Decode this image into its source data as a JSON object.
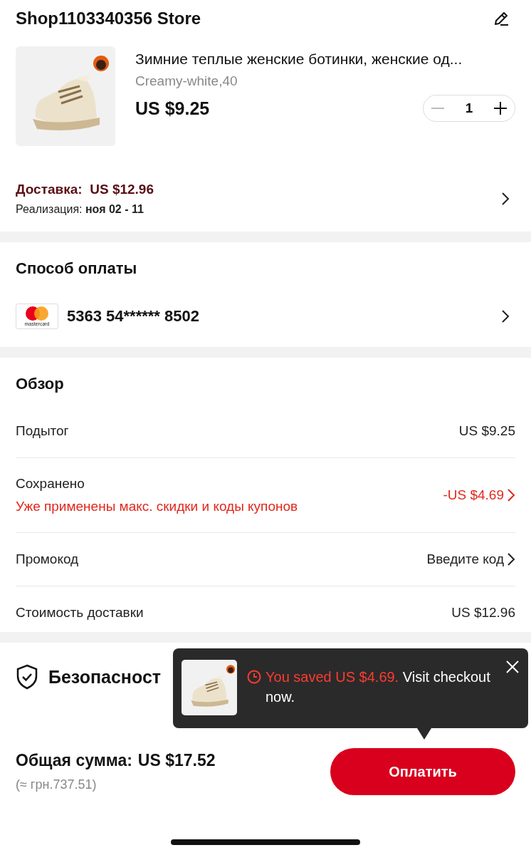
{
  "store": {
    "name": "Shop1103340356 Store"
  },
  "product": {
    "title": "Зимние теплые женские ботинки, женские од...",
    "variant": "Creamy-white,40",
    "price": "US $9.25",
    "quantity": "1"
  },
  "delivery": {
    "label": "Доставка:",
    "price": "US $12.96",
    "eta_label": "Реализация:",
    "eta": "ноя 02 - 11"
  },
  "payment": {
    "title": "Способ оплаты",
    "card_brand": "mastercard",
    "card_number": "5363 54****** 8502"
  },
  "overview": {
    "title": "Обзор",
    "rows": [
      {
        "kind": "plain",
        "label": "Подытог",
        "value": "US $9.25"
      },
      {
        "kind": "saved",
        "label": "Сохранено",
        "note": "Уже применены макс. скидки и коды купонов",
        "value": "-US $4.69"
      },
      {
        "kind": "link",
        "label": "Промокод",
        "value": "Введите код"
      },
      {
        "kind": "plain",
        "label": "Стоимость доставки",
        "value": "US $12.96"
      }
    ]
  },
  "security": {
    "title": "Безопасност"
  },
  "toast": {
    "highlight": "You saved US $4.69.",
    "text": "Visit checkout now."
  },
  "total": {
    "label": "Общая сумма:",
    "value": "US $17.52",
    "converted": "(≈ грн.737.51)"
  },
  "pay_button": "Оплатить"
}
